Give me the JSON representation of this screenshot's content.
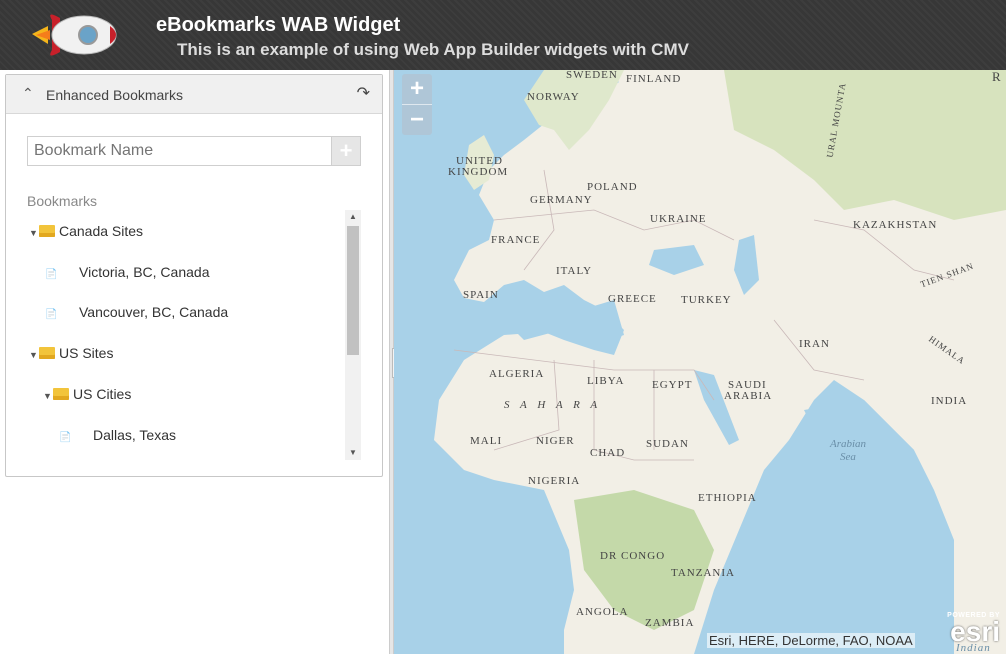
{
  "header": {
    "title": "eBookmarks WAB Widget",
    "subtitle": "This is an example of using Web App Builder widgets with CMV"
  },
  "panel": {
    "title": "Enhanced Bookmarks",
    "input_placeholder": "Bookmark Name",
    "bookmarks_label": "Bookmarks",
    "tree": [
      {
        "label": "Canada Sites",
        "type": "folder"
      },
      {
        "label": "Victoria, BC, Canada",
        "type": "bookmark"
      },
      {
        "label": "Vancouver, BC, Canada",
        "type": "bookmark"
      },
      {
        "label": "US Sites",
        "type": "folder"
      },
      {
        "label": "US Cities",
        "type": "folder"
      },
      {
        "label": "Dallas, Texas",
        "type": "bookmark"
      }
    ]
  },
  "map": {
    "zoom_in": "+",
    "zoom_out": "−",
    "labels": {
      "sweden": "SWEDEN",
      "finland": "FINLAND",
      "norway": "NORWAY",
      "uk1": "UNITED",
      "uk2": "KINGDOM",
      "poland": "POLAND",
      "germany": "GERMANY",
      "ukraine": "UKRAINE",
      "kazakhstan": "KAZAKHSTAN",
      "france": "FRANCE",
      "italy": "ITALY",
      "spain": "SPAIN",
      "greece": "GREECE",
      "turkey": "TURKEY",
      "tienshan": "TIEN SHAN",
      "iran": "IRAN",
      "himalaya": "HIMALA",
      "algeria": "ALGERIA",
      "libya": "LIBYA",
      "egypt": "EGYPT",
      "saudi1": "SAUDI",
      "saudi2": "ARABIA",
      "india": "INDIA",
      "sahara": "S A H A R A",
      "mali": "MALI",
      "niger": "NIGER",
      "chad": "CHAD",
      "sudan": "SUDAN",
      "arabian1": "Arabian",
      "arabian2": "Sea",
      "nigeria": "NIGERIA",
      "ethiopia": "ETHIOPIA",
      "drcongo": "DR CONGO",
      "tanzania": "TANZANIA",
      "angola": "ANGOLA",
      "zambia": "ZAMBIA",
      "ural": "URAL MOUNTA",
      "r": "R",
      "indian": "Indian"
    },
    "attribution": "Esri, HERE, DeLorme, FAO, NOAA",
    "esri_powered": "POWERED BY",
    "esri_logo": "esri"
  },
  "colors": {
    "header_bg": "#373737",
    "ocean": "#a8d1e8",
    "land": "#f2efe6",
    "green": "#cfe0b4"
  }
}
